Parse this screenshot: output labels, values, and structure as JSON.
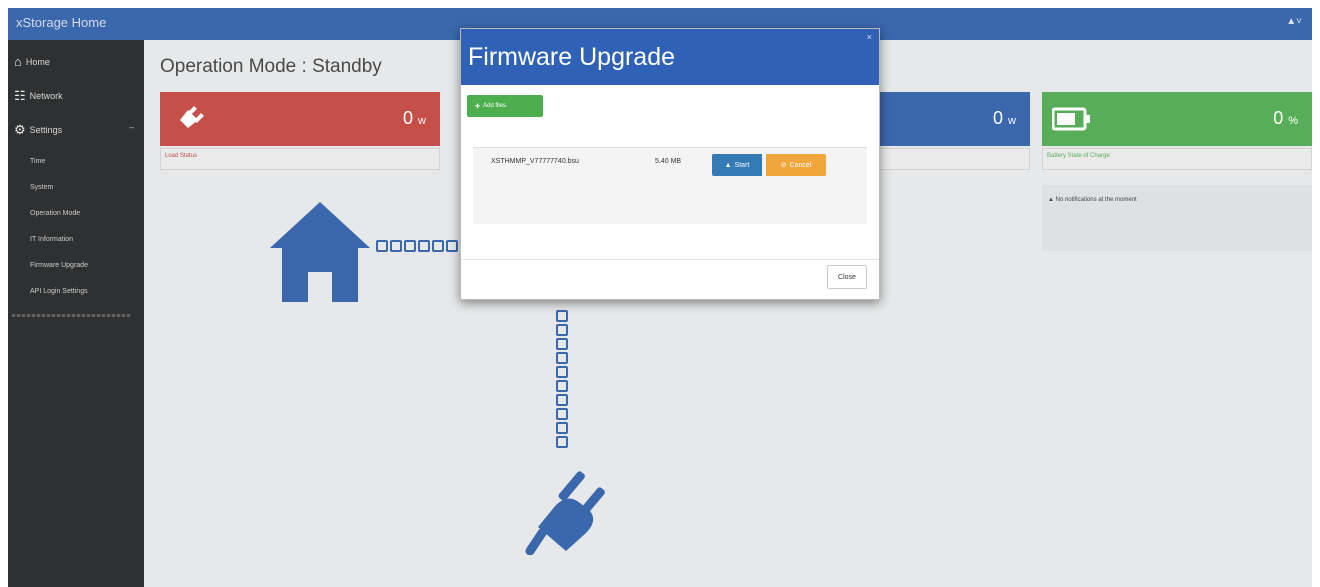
{
  "topbar": {
    "brand": "xStorage Home",
    "user_icon": "user-icon"
  },
  "sidebar": {
    "home": "Home",
    "network": "Network",
    "settings": "Settings",
    "sub_items": [
      "Time",
      "System",
      "Operation Mode",
      "IT Information",
      "Firmware Upgrade",
      "API Login Settings"
    ]
  },
  "main": {
    "title": "Operation Mode : Standby",
    "tiles": [
      {
        "value": "0",
        "unit": "w",
        "label": "Load Status",
        "color": "#c1413a"
      },
      {
        "value": "0",
        "unit": "w",
        "label": "",
        "color": "#2b5ba6"
      },
      {
        "value": "0",
        "unit": "%",
        "label": "Battery State of Charge",
        "color": "#4aa84a"
      }
    ],
    "notification": "No notifications at the moment"
  },
  "modal": {
    "title": "Firmware Upgrade",
    "add_label": "Add files",
    "file_name": "XSTHMMP_V77777740.bsu",
    "file_size": "5.40 MB",
    "start_label": "Start",
    "cancel_label": "Cancel",
    "close_label": "Close"
  }
}
